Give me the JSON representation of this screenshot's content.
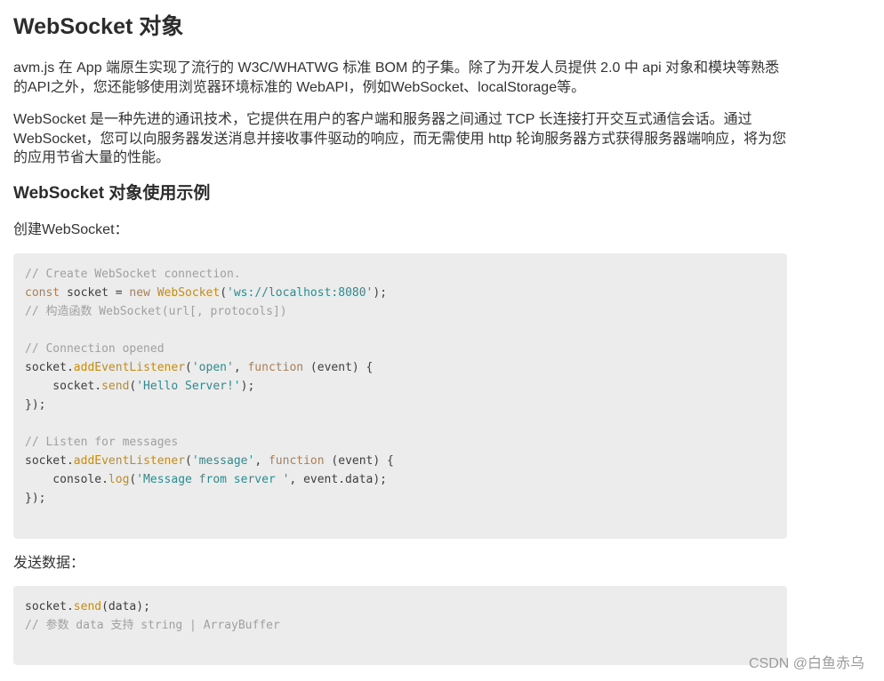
{
  "title": "WebSocket 对象",
  "intro_paragraph": "avm.js 在 App 端原生实现了流行的 W3C/WHATWG 标准 BOM 的子集。除了为开发人员提供 2.0 中 api 对象和模块等熟悉的API之外，您还能够使用浏览器环境标准的 WebAPI，例如WebSocket、localStorage等。",
  "websocket_paragraph": "WebSocket 是一种先进的通讯技术，它提供在用户的客户端和服务器之间通过 TCP 长连接打开交互式通信会话。通过 WebSocket，您可以向服务器发送消息并接收事件驱动的响应，而无需使用 http 轮询服务器方式获得服务器端响应，将为您的应用节省大量的性能。",
  "section_heading": "WebSocket 对象使用示例",
  "create_label": "创建WebSocket：",
  "send_label": "发送数据：",
  "code_create": [
    [
      {
        "t": "comment",
        "v": "// Create WebSocket connection."
      }
    ],
    [
      {
        "t": "kw",
        "v": "const"
      },
      {
        "t": "plain",
        "v": " socket = "
      },
      {
        "t": "kw",
        "v": "new"
      },
      {
        "t": "plain",
        "v": " "
      },
      {
        "t": "class",
        "v": "WebSocket"
      },
      {
        "t": "plain",
        "v": "("
      },
      {
        "t": "str",
        "v": "'ws://localhost:8080'"
      },
      {
        "t": "plain",
        "v": ");"
      }
    ],
    [
      {
        "t": "comment",
        "v": "// 构造函数 WebSocket(url[, protocols])"
      }
    ],
    [],
    [
      {
        "t": "comment",
        "v": "// Connection opened"
      }
    ],
    [
      {
        "t": "plain",
        "v": "socket."
      },
      {
        "t": "fn",
        "v": "addEventListener"
      },
      {
        "t": "plain",
        "v": "("
      },
      {
        "t": "str",
        "v": "'open'"
      },
      {
        "t": "plain",
        "v": ", "
      },
      {
        "t": "kw",
        "v": "function"
      },
      {
        "t": "plain",
        "v": " (event) {"
      }
    ],
    [
      {
        "t": "plain",
        "v": "    socket."
      },
      {
        "t": "fn",
        "v": "send"
      },
      {
        "t": "plain",
        "v": "("
      },
      {
        "t": "str",
        "v": "'Hello Server!'"
      },
      {
        "t": "plain",
        "v": ");"
      }
    ],
    [
      {
        "t": "plain",
        "v": "});"
      }
    ],
    [],
    [
      {
        "t": "comment",
        "v": "// Listen for messages"
      }
    ],
    [
      {
        "t": "plain",
        "v": "socket."
      },
      {
        "t": "fn",
        "v": "addEventListener"
      },
      {
        "t": "plain",
        "v": "("
      },
      {
        "t": "str",
        "v": "'message'"
      },
      {
        "t": "plain",
        "v": ", "
      },
      {
        "t": "kw",
        "v": "function"
      },
      {
        "t": "plain",
        "v": " (event) {"
      }
    ],
    [
      {
        "t": "plain",
        "v": "    console."
      },
      {
        "t": "fn",
        "v": "log"
      },
      {
        "t": "plain",
        "v": "("
      },
      {
        "t": "str",
        "v": "'Message from server '"
      },
      {
        "t": "plain",
        "v": ", event.data);"
      }
    ],
    [
      {
        "t": "plain",
        "v": "});"
      }
    ]
  ],
  "code_send": [
    [
      {
        "t": "plain",
        "v": "socket."
      },
      {
        "t": "fn",
        "v": "send"
      },
      {
        "t": "plain",
        "v": "(data);"
      }
    ],
    [
      {
        "t": "comment",
        "v": "// 参数 data 支持 string | ArrayBuffer"
      }
    ]
  ],
  "watermark": "CSDN @白鱼赤乌",
  "colors": {
    "code_background": "#ececec",
    "comment": "#a0a0a0",
    "keyword": "#a67f59",
    "string": "#2e8a8e",
    "function": "#c18c1c"
  }
}
